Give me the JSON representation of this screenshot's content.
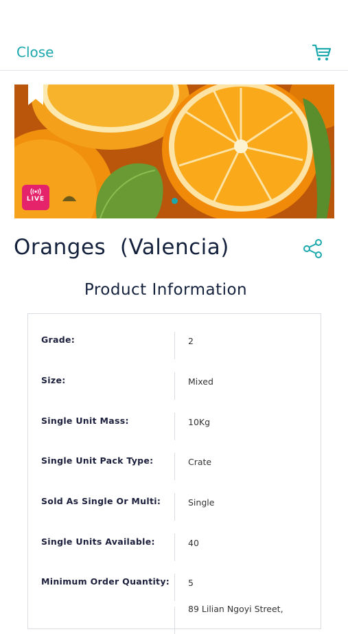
{
  "header": {
    "close_label": "Close",
    "cart_icon": "cart-icon"
  },
  "hero": {
    "image_subject": "sliced oranges with leaves",
    "live_label": "LIVE",
    "carousel_active_index": 0,
    "carousel_count": 1
  },
  "product": {
    "title": "Oranges  (Valencia)"
  },
  "info": {
    "heading": "Product Information",
    "rows": [
      {
        "label": "Grade:",
        "value": "2"
      },
      {
        "label": "Size:",
        "value": "Mixed"
      },
      {
        "label": "Single Unit Mass:",
        "value": "10Kg"
      },
      {
        "label": "Single Unit Pack Type:",
        "value": "Crate"
      },
      {
        "label": "Sold As Single Or Multi:",
        "value": "Single"
      },
      {
        "label": "Single Units Available:",
        "value": "40"
      },
      {
        "label": "Minimum Order Quantity:",
        "value": "5"
      },
      {
        "label": "",
        "value": "89 Lilian Ngoyi Street,"
      }
    ]
  },
  "colors": {
    "accent": "#1aa8ad",
    "title": "#14213d",
    "live_badge": "#e4236b"
  }
}
